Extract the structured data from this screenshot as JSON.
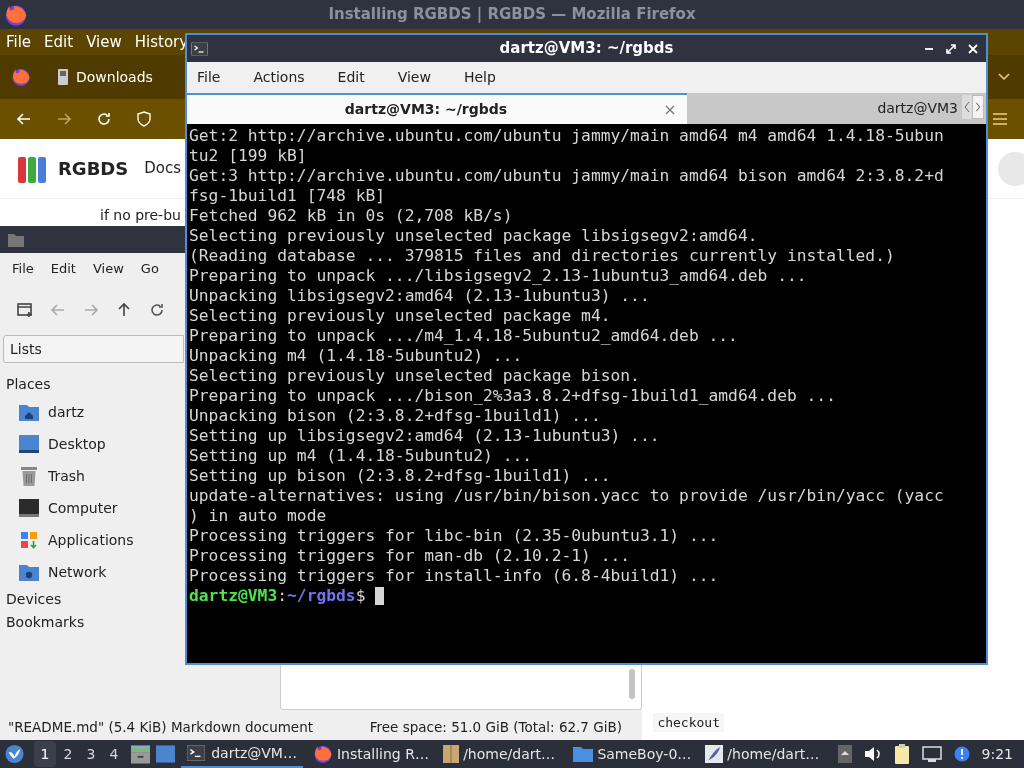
{
  "firefox": {
    "title": "Installing RGBDS | RGBDS — Mozilla Firefox",
    "menu": [
      "File",
      "Edit",
      "View",
      "History"
    ],
    "bookmark": "Downloads",
    "site_name": "RGBDS",
    "nav_link": "Docs",
    "page_text": "if no pre-bu",
    "code_text": "checkout"
  },
  "file_manager": {
    "menu": [
      "File",
      "Edit",
      "View",
      "Go"
    ],
    "location": "Lists",
    "sections": [
      {
        "label": "Places",
        "items": [
          {
            "label": "dartz",
            "kind": "home"
          },
          {
            "label": "Desktop",
            "kind": "desktop"
          },
          {
            "label": "Trash",
            "kind": "trash"
          },
          {
            "label": "Computer",
            "kind": "computer"
          },
          {
            "label": "Applications",
            "kind": "apps"
          },
          {
            "label": "Network",
            "kind": "network"
          }
        ]
      },
      {
        "label": "Devices"
      },
      {
        "label": "Bookmarks"
      }
    ],
    "status": "\"README.md\" (5.4 KiB) Markdown document",
    "free_space": "Free space: 51.0 GiB (Total: 62.7 GiB)"
  },
  "terminal": {
    "title": "dartz@VM3: ~/rgbds",
    "menu": [
      "File",
      "Actions",
      "Edit",
      "View",
      "Help"
    ],
    "tabs": [
      {
        "label": "dartz@VM3: ~/rgbds",
        "selected": true
      },
      {
        "label": "dartz@VM3",
        "selected": false
      }
    ],
    "lines": [
      "Get:2 http://archive.ubuntu.com/ubuntu jammy/main amd64 m4 amd64 1.4.18-5ubun",
      "tu2 [199 kB]",
      "Get:3 http://archive.ubuntu.com/ubuntu jammy/main amd64 bison amd64 2:3.8.2+d",
      "fsg-1build1 [748 kB]",
      "Fetched 962 kB in 0s (2,708 kB/s)",
      "Selecting previously unselected package libsigsegv2:amd64.",
      "(Reading database ... 379815 files and directories currently installed.)",
      "Preparing to unpack .../libsigsegv2_2.13-1ubuntu3_amd64.deb ...",
      "Unpacking libsigsegv2:amd64 (2.13-1ubuntu3) ...",
      "Selecting previously unselected package m4.",
      "Preparing to unpack .../m4_1.4.18-5ubuntu2_amd64.deb ...",
      "Unpacking m4 (1.4.18-5ubuntu2) ...",
      "Selecting previously unselected package bison.",
      "Preparing to unpack .../bison_2%3a3.8.2+dfsg-1build1_amd64.deb ...",
      "Unpacking bison (2:3.8.2+dfsg-1build1) ...",
      "Setting up libsigsegv2:amd64 (2.13-1ubuntu3) ...",
      "Setting up m4 (1.4.18-5ubuntu2) ...",
      "Setting up bison (2:3.8.2+dfsg-1build1) ...",
      "update-alternatives: using /usr/bin/bison.yacc to provide /usr/bin/yacc (yacc",
      ") in auto mode",
      "Processing triggers for libc-bin (2.35-0ubuntu3.1) ...",
      "Processing triggers for man-db (2.10.2-1) ...",
      "Processing triggers for install-info (6.8-4build1) ..."
    ],
    "prompt": {
      "user": "dartz@VM3",
      "sep": ":",
      "path": "~/rgbds",
      "symbol": "$"
    }
  },
  "taskbar": {
    "workspaces": [
      {
        "label": "1",
        "selected": true
      },
      {
        "label": "2",
        "selected": false
      },
      {
        "label": "3",
        "selected": false
      },
      {
        "label": "4",
        "selected": false
      }
    ],
    "tasks": [
      {
        "label": "dartz@VM…",
        "kind": "terminal",
        "selected": true
      },
      {
        "label": "Installing R…",
        "kind": "browser",
        "selected": false
      },
      {
        "label": "/home/dart…",
        "kind": "archive",
        "selected": false
      },
      {
        "label": "SameBoy-0…",
        "kind": "folder",
        "selected": false
      },
      {
        "label": "/home/dart…",
        "kind": "editor",
        "selected": false
      }
    ],
    "clock": "9:21"
  }
}
